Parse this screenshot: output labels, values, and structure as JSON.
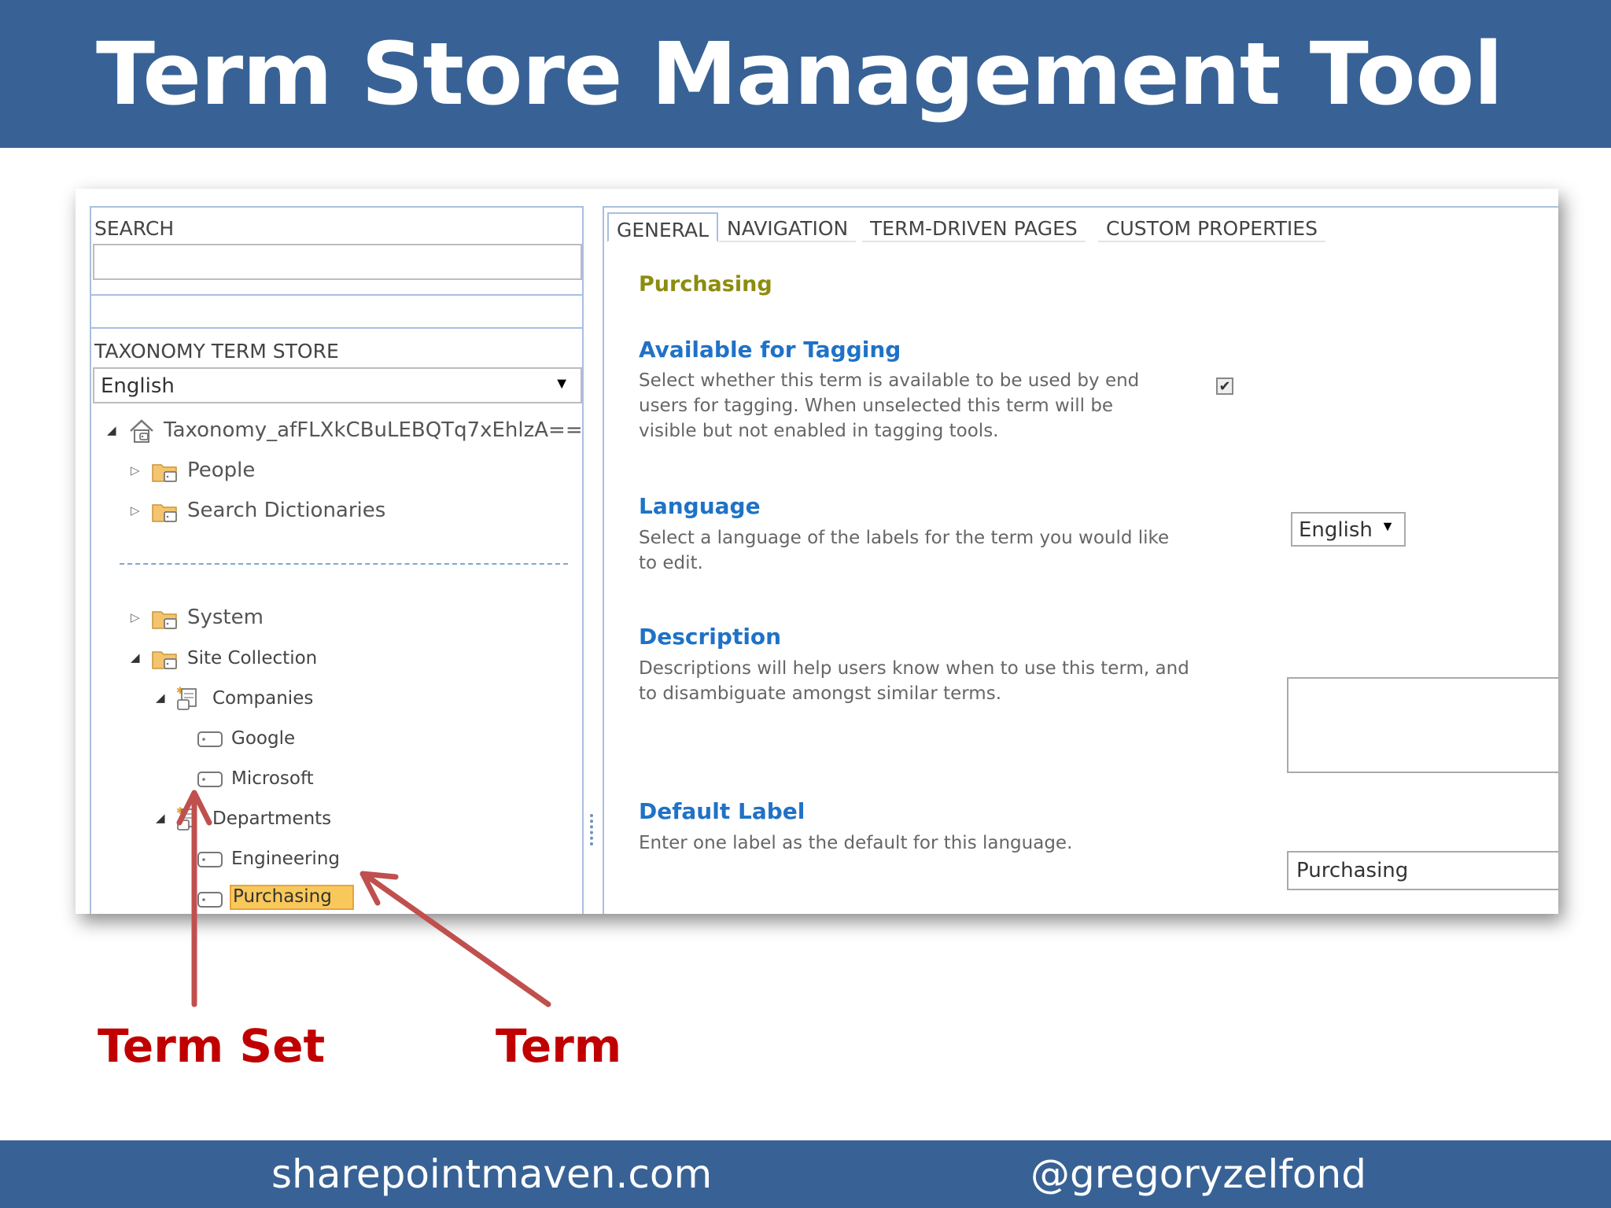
{
  "slide": {
    "title": "Term Store Management Tool",
    "footer_site": "sharepointmaven.com",
    "footer_handle": "@gregoryzelfond",
    "callout_term_set": "Term Set",
    "callout_term": "Term",
    "colors": {
      "header_bar": "#386295",
      "callout": "#c00000",
      "accent_blue": "#1f72c6",
      "selected_term_bg": "#f8c85a"
    }
  },
  "left_panel": {
    "search_label": "SEARCH",
    "search_value": "",
    "store_label": "TAXONOMY TERM STORE",
    "language_selected": "English",
    "tree": {
      "root": "Taxonomy_afFLXkCBuLEBQTq7xEhlzA==",
      "people": "People",
      "search_dictionaries": "Search Dictionaries",
      "system": "System",
      "site_collection": "Site Collection",
      "companies": "Companies",
      "google": "Google",
      "microsoft": "Microsoft",
      "departments": "Departments",
      "engineering": "Engineering",
      "purchasing": "Purchasing"
    }
  },
  "right_panel": {
    "tabs": [
      "GENERAL",
      "NAVIGATION",
      "TERM-DRIVEN PAGES",
      "CUSTOM PROPERTIES"
    ],
    "active_tab": "GENERAL",
    "term_name": "Purchasing",
    "available": {
      "title": "Available for Tagging",
      "description": "Select whether this term is available to be used by end users for tagging. When unselected this term will be visible but not enabled in tagging tools.",
      "checked": true
    },
    "language": {
      "title": "Language",
      "description": "Select a language of the labels for the term you would like to edit.",
      "selected": "English"
    },
    "description": {
      "title": "Description",
      "description": "Descriptions will help users know when to use this term, and to disambiguate amongst similar terms.",
      "value": ""
    },
    "default_label": {
      "title": "Default Label",
      "description": "Enter one label as the default for this language.",
      "value": "Purchasing"
    }
  }
}
